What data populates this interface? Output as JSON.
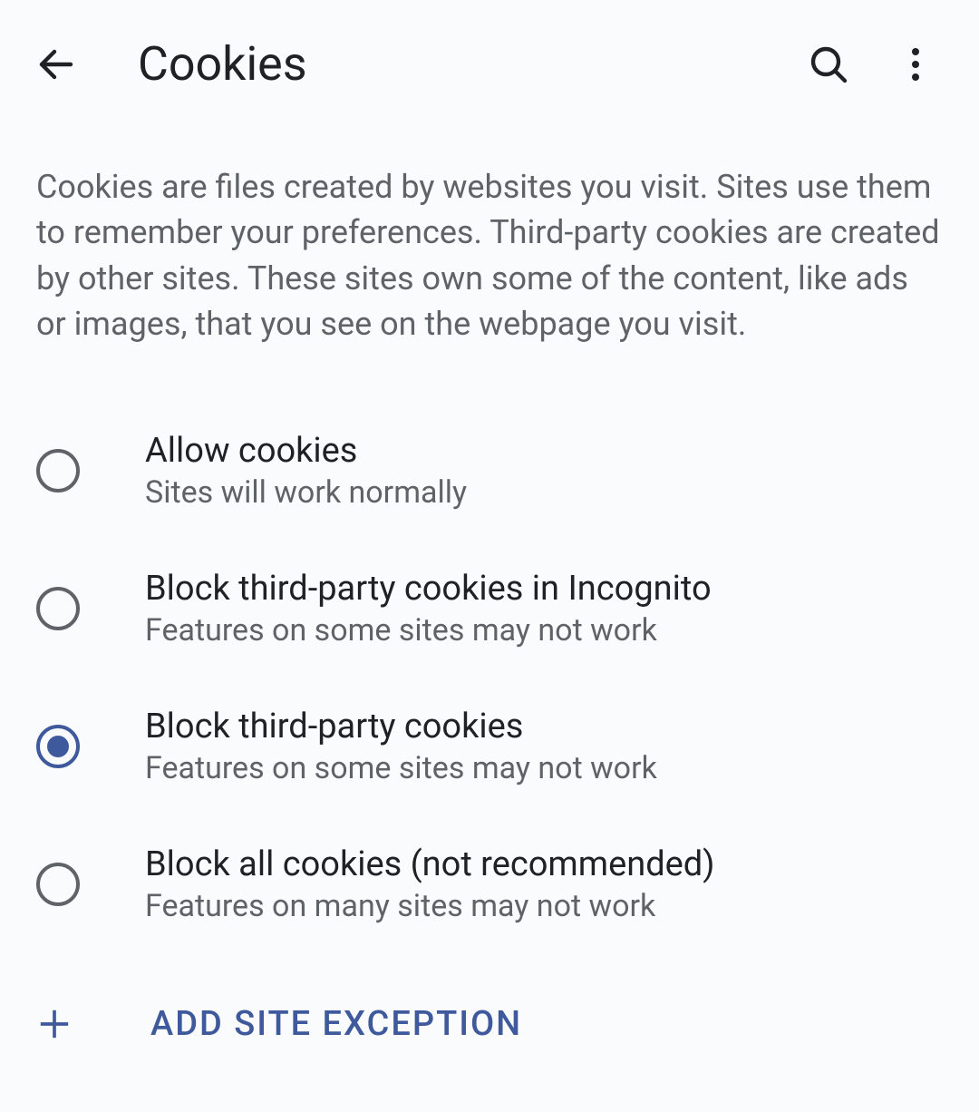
{
  "header": {
    "title": "Cookies"
  },
  "description": "Cookies are files created by websites you visit. Sites use them to remember your preferences. Third-party cookies are created by other sites. These sites own some of the content, like ads or images, that you see on the webpage you visit.",
  "options": [
    {
      "title": "Allow cookies",
      "subtitle": "Sites will work normally",
      "selected": false
    },
    {
      "title": "Block third-party cookies in Incognito",
      "subtitle": "Features on some sites may not work",
      "selected": false
    },
    {
      "title": "Block third-party cookies",
      "subtitle": "Features on some sites may not work",
      "selected": true
    },
    {
      "title": "Block all cookies (not recommended)",
      "subtitle": "Features on many sites may not work",
      "selected": false
    }
  ],
  "add_exception_label": "ADD SITE EXCEPTION"
}
